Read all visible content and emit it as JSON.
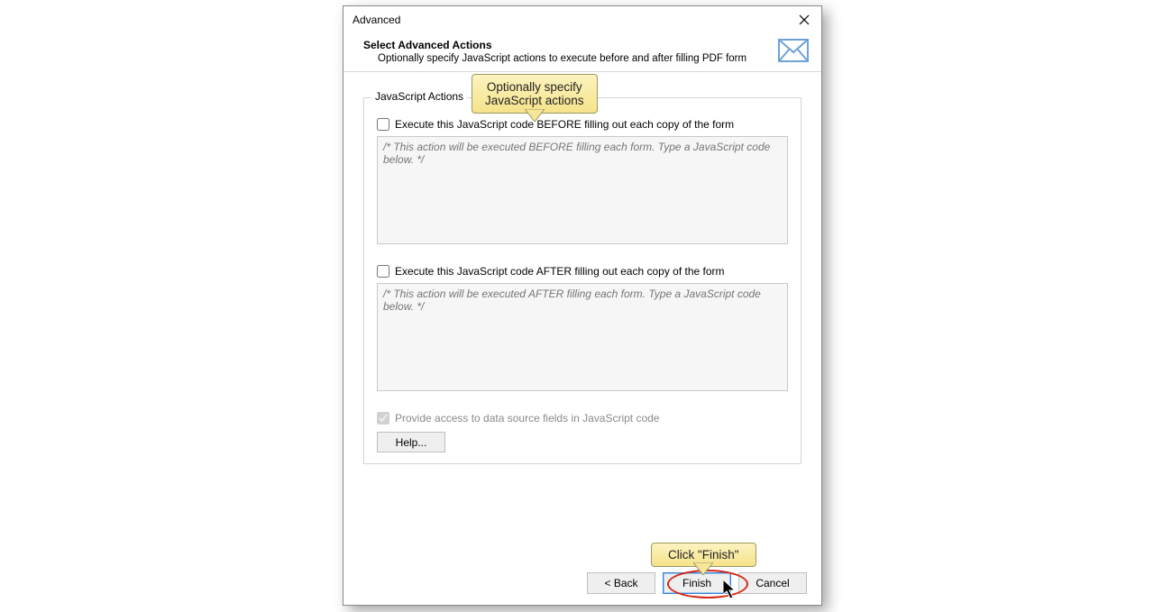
{
  "dialog": {
    "title": "Advanced"
  },
  "header": {
    "heading": "Select Advanced Actions",
    "subheading": "Optionally specify JavaScript actions to execute before and after filling PDF form"
  },
  "group": {
    "legend": "JavaScript Actions",
    "before": {
      "checkbox_label": "Execute this JavaScript code BEFORE filling out each copy of the form",
      "placeholder": "/* This action will be executed BEFORE filling each form. Type a JavaScript code below. */"
    },
    "after": {
      "checkbox_label": "Execute this JavaScript code AFTER filling out each copy of the form",
      "placeholder": "/* This action will be executed AFTER filling each form. Type a JavaScript code below. */"
    },
    "provide_access_label": "Provide access to data source fields in JavaScript code",
    "help_label": "Help..."
  },
  "buttons": {
    "back": "< Back",
    "finish": "Finish",
    "cancel": "Cancel"
  },
  "callouts": {
    "top_line1": "Optionally specify",
    "top_line2": "JavaScript actions",
    "bottom": "Click \"Finish\""
  }
}
